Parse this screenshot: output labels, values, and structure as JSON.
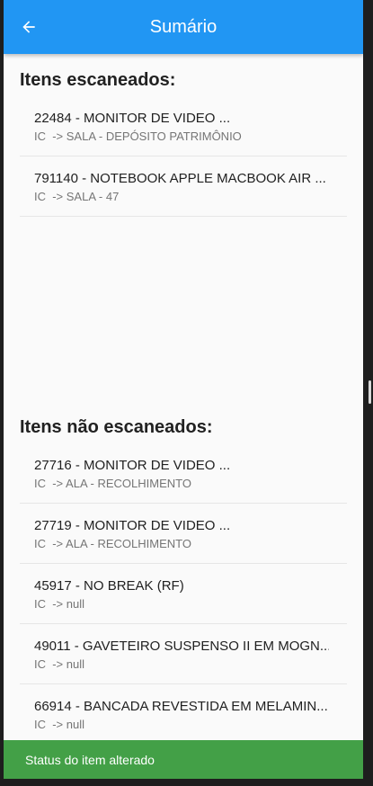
{
  "appbar": {
    "title": "Sumário",
    "back_icon": "arrow-left-icon"
  },
  "scanned": {
    "title": "Itens escaneados:",
    "items": [
      {
        "title": "22484 - MONITOR DE VIDEO ...",
        "subtitle": "IC  -> SALA - DEPÓSITO PATRIMÔNIO"
      },
      {
        "title": "791140 - NOTEBOOK APPLE MACBOOK AIR ...",
        "subtitle": "IC  -> SALA - 47"
      }
    ]
  },
  "not_scanned": {
    "title": "Itens não escaneados:",
    "items": [
      {
        "title": "27716 - MONITOR DE VIDEO ...",
        "subtitle": "IC  -> ALA - RECOLHIMENTO"
      },
      {
        "title": "27719 - MONITOR DE VIDEO ...",
        "subtitle": "IC  -> ALA - RECOLHIMENTO"
      },
      {
        "title": "45917 - NO BREAK (RF)",
        "subtitle": "IC  -> null"
      },
      {
        "title": "49011 - GAVETEIRO SUSPENSO II EM MOGN...",
        "subtitle": "IC  -> null"
      },
      {
        "title": "66914 - BANCADA REVESTIDA EM MELAMIN...",
        "subtitle": "IC  -> null"
      }
    ]
  },
  "snackbar": {
    "message": "Status do item alterado"
  },
  "colors": {
    "appbar": "#2196f3",
    "snackbar": "#43a047"
  }
}
